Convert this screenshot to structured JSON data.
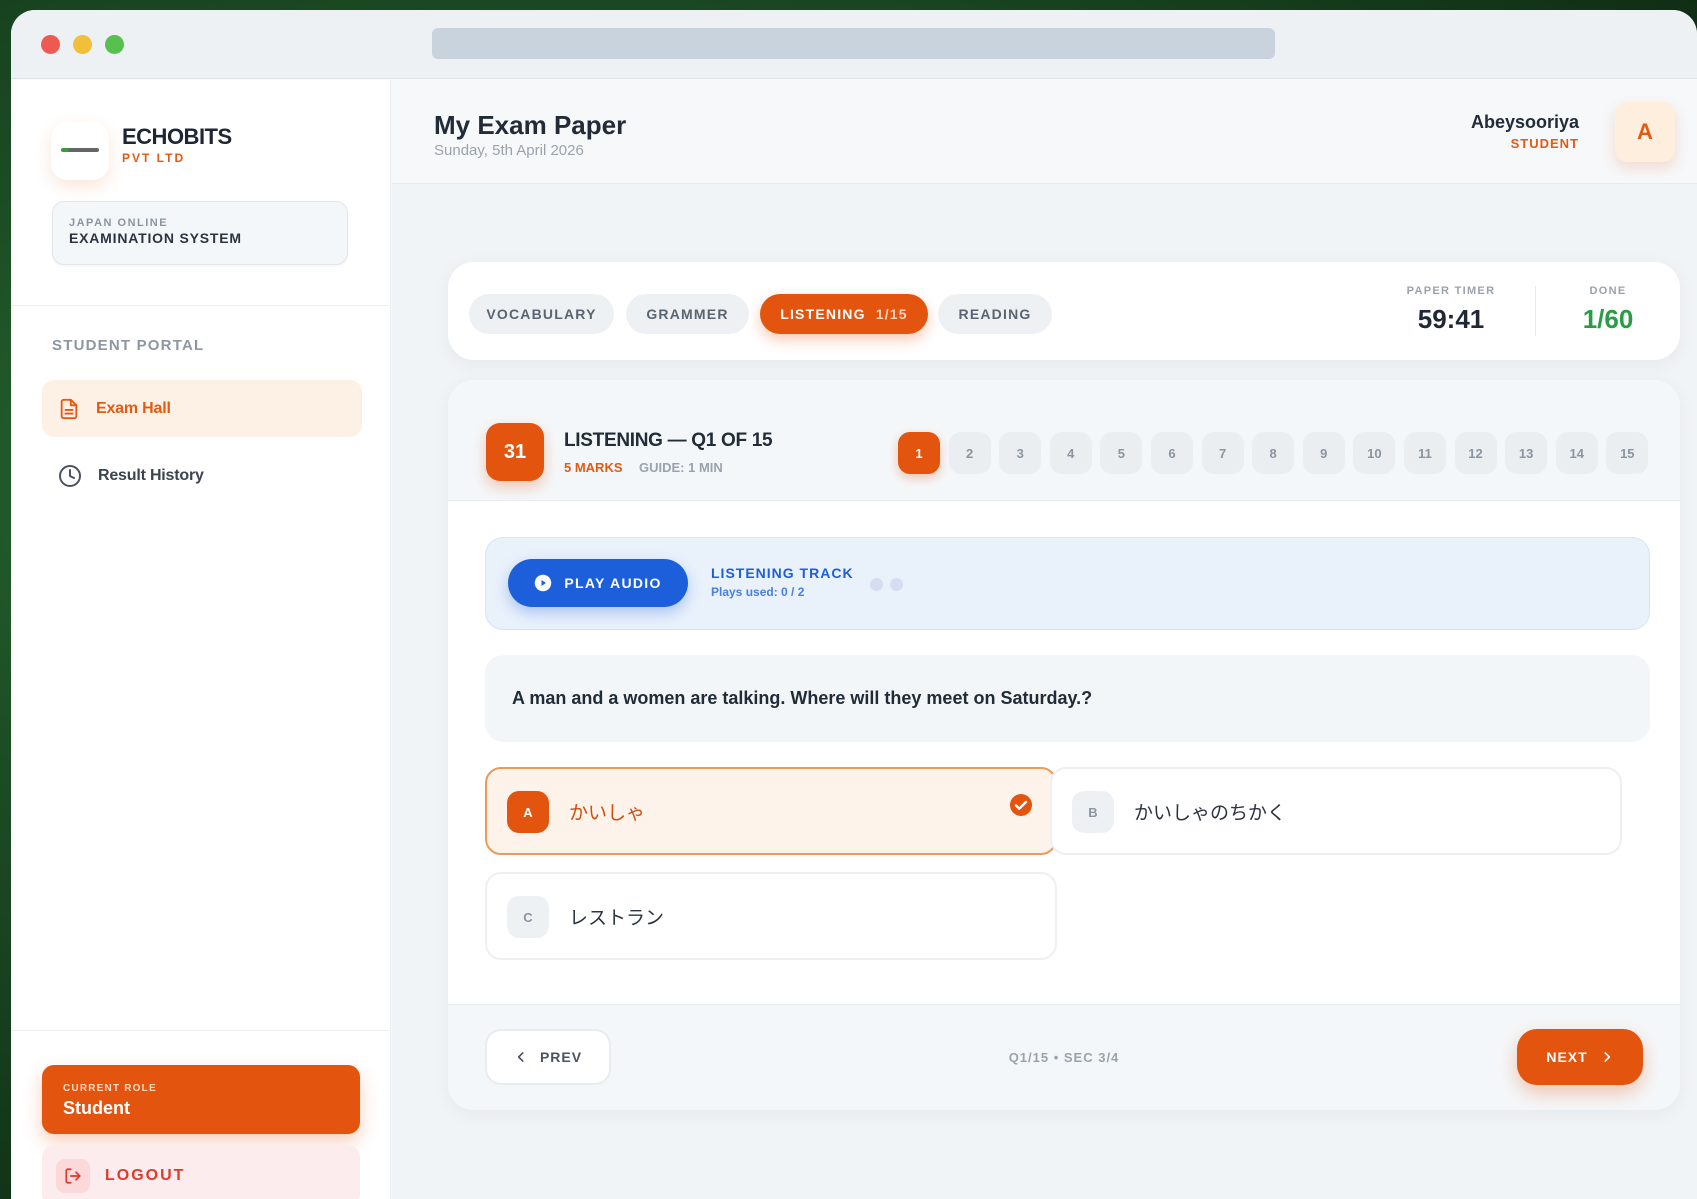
{
  "sidebar": {
    "brand_name": "ECHOBITS",
    "brand_sub": "PVT LTD",
    "system_small": "JAPAN ONLINE",
    "system_big": "EXAMINATION SYSTEM",
    "portal_label": "STUDENT PORTAL",
    "items": [
      {
        "label": "Exam Hall",
        "icon": "document-icon",
        "active": true
      },
      {
        "label": "Result History",
        "icon": "clock-icon",
        "active": false
      }
    ],
    "role_small": "CURRENT ROLE",
    "role_value": "Student",
    "logout_label": "LOGOUT"
  },
  "header": {
    "title": "My Exam Paper",
    "date": "Sunday, 5th April 2026",
    "user_name": "Abeysooriya",
    "user_role": "STUDENT",
    "avatar_letter": "A"
  },
  "tabs": {
    "items": [
      {
        "label": "VOCABULARY"
      },
      {
        "label": "GRAMMER"
      },
      {
        "label": "LISTENING",
        "count": "1/15",
        "active": true
      },
      {
        "label": "READING"
      }
    ],
    "timer_label": "PAPER TIMER",
    "timer_value": "59:41",
    "done_label": "DONE",
    "done_value": "1/60"
  },
  "question": {
    "number": "31",
    "title": "LISTENING — Q1 OF 15",
    "marks": "5 MARKS",
    "guide": "GUIDE: 1 MIN",
    "nav": [
      "1",
      "2",
      "3",
      "4",
      "5",
      "6",
      "7",
      "8",
      "9",
      "10",
      "11",
      "12",
      "13",
      "14",
      "15"
    ],
    "active_nav": "1",
    "audio": {
      "button_label": "PLAY AUDIO",
      "track_title": "LISTENING TRACK",
      "plays_used": "Plays used: 0 / 2"
    },
    "text": "A man and a women are talking. Where will they meet on Saturday.?",
    "options": [
      {
        "letter": "A",
        "text": "かいしゃ",
        "selected": true
      },
      {
        "letter": "B",
        "text": "かいしゃのちかく",
        "selected": false
      },
      {
        "letter": "C",
        "text": "レストラン",
        "selected": false
      }
    ]
  },
  "footer": {
    "prev_label": "PREV",
    "info": "Q1/15 • SEC 3/4",
    "next_label": "NEXT"
  },
  "colors": {
    "accent": "#e3540e",
    "blue": "#1d5fdb",
    "done_green": "#2a9c45",
    "logout_red": "#e0392b"
  }
}
